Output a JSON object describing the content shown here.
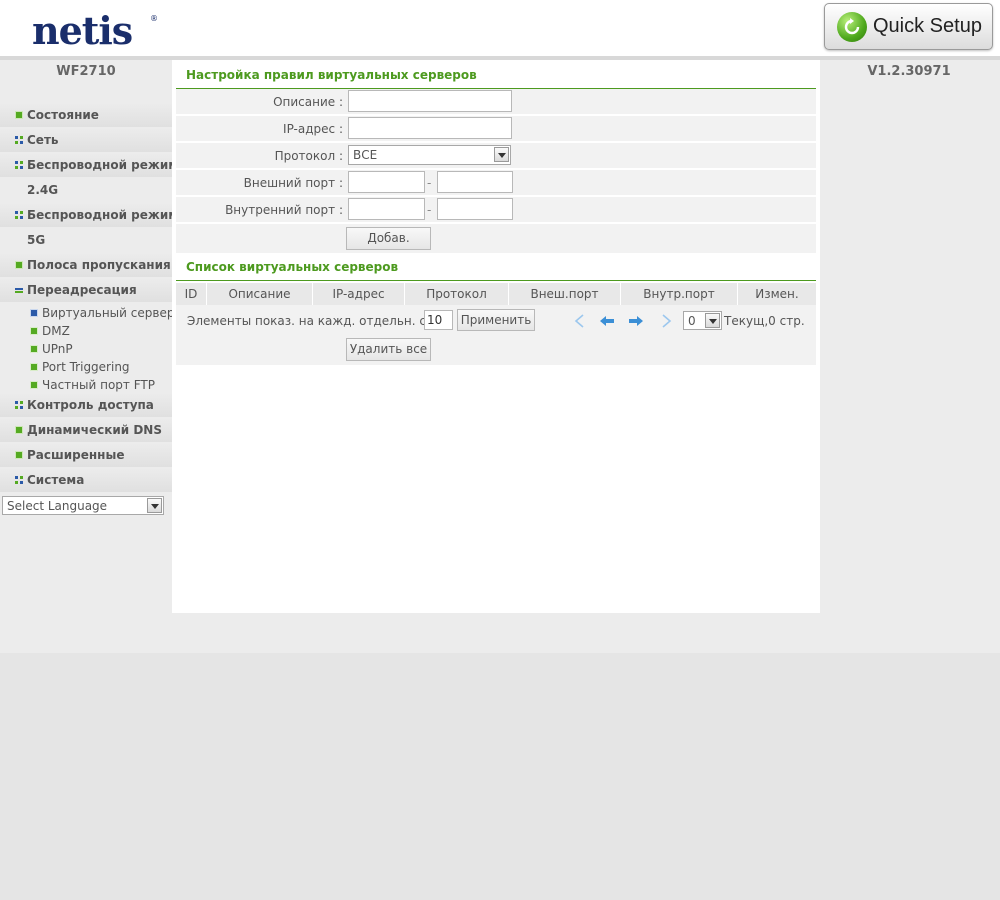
{
  "header": {
    "logo": "netis",
    "logo_mark": "®",
    "quick_setup": "Quick Setup"
  },
  "model": "WF2710",
  "version": "V1.2.30971",
  "sidebar": {
    "items": [
      {
        "label": "Состояние"
      },
      {
        "label": "Сеть"
      },
      {
        "label": "Беспроводной режим"
      },
      {
        "label": "2.4G"
      },
      {
        "label": "Беспроводной режим"
      },
      {
        "label": "5G"
      },
      {
        "label": "Полоса пропускания"
      },
      {
        "label": "Переадресация"
      },
      {
        "label": "Контроль доступа"
      },
      {
        "label": "Динамический DNS"
      },
      {
        "label": "Расширенные"
      },
      {
        "label": "Система"
      }
    ],
    "subitems": [
      {
        "label": "Виртуальный сервер"
      },
      {
        "label": "DMZ"
      },
      {
        "label": "UPnP"
      },
      {
        "label": "Port Triggering"
      },
      {
        "label": "Частный порт FTP"
      }
    ],
    "language": "Select Language"
  },
  "form": {
    "title": "Настройка правил виртуальных серверов",
    "description_label": "Описание :",
    "description_value": "",
    "ip_label": "IP-адрес :",
    "ip_value": "",
    "protocol_label": "Протокол :",
    "protocol_value": "ВСЕ",
    "ext_port_label": "Внешний порт :",
    "int_port_label": "Внутренний порт :",
    "dash": "-",
    "add_button": "Добав."
  },
  "list": {
    "title": "Список виртуальных серверов",
    "columns": [
      "ID",
      "Описание",
      "IP-адрес",
      "Протокол",
      "Внеш.порт",
      "Внутр.порт",
      "Измен."
    ],
    "per_page_label": "Элементы показ. на кажд. отдельн. стр.",
    "per_page_value": "10",
    "apply_button": "Применить",
    "page_select": "0",
    "current_page": "Текущ,0 стр.",
    "delete_all": "Удалить все"
  },
  "colors": {
    "accent_green": "#4d9a1f",
    "logo_blue": "#1a2e6b",
    "arrow_blue": "#3b8fd6"
  }
}
